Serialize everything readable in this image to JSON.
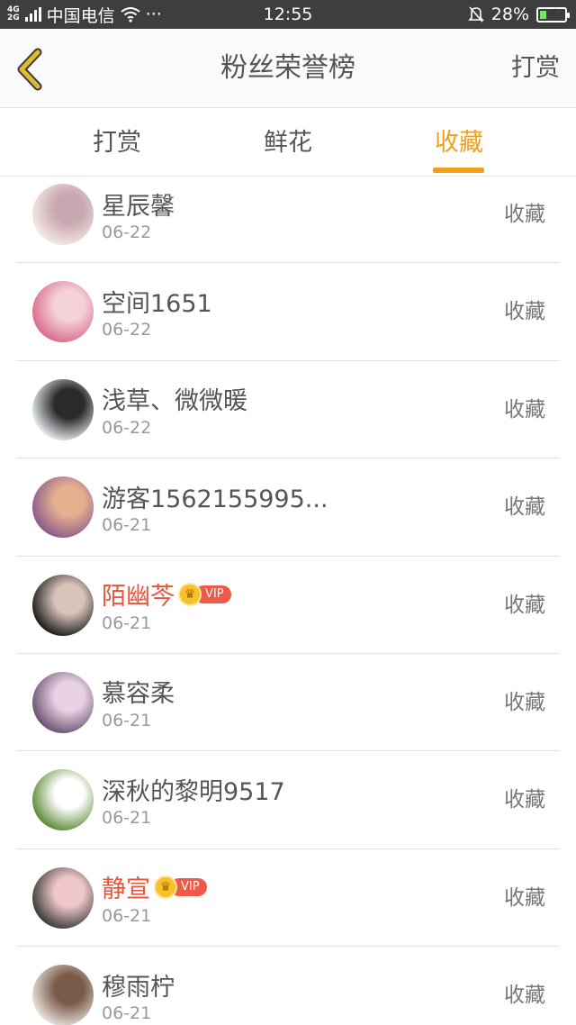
{
  "status_bar": {
    "network_top": "4G",
    "network_bottom": "2G",
    "carrier": "中国电信",
    "wifi_icon": "wifi-icon",
    "more": "···",
    "time": "12:55",
    "battery_percent": "28%",
    "battery_level": 0.28
  },
  "header": {
    "back_icon": "chevron-left-icon",
    "title": "粉丝荣誉榜",
    "action": "打赏"
  },
  "tabs": [
    {
      "label": "打赏",
      "active": false
    },
    {
      "label": "鲜花",
      "active": false
    },
    {
      "label": "收藏",
      "active": true
    }
  ],
  "colors": {
    "accent": "#f0a01a",
    "vip_name": "#e8553a",
    "back_icon": "#e2ba2c"
  },
  "list": [
    {
      "name": "星辰馨",
      "date": "06-22",
      "action": "收藏",
      "vip": false,
      "avatar_colors": [
        "#f3e9e6",
        "#c9a7b0"
      ]
    },
    {
      "name": "空间1651",
      "date": "06-22",
      "action": "收藏",
      "vip": false,
      "avatar_colors": [
        "#d86c8b",
        "#f5d2da"
      ]
    },
    {
      "name": "浅草、微微暖",
      "date": "06-22",
      "action": "收藏",
      "vip": false,
      "avatar_colors": [
        "#e9edf1",
        "#2a2a2a"
      ]
    },
    {
      "name": "游客1562155995...",
      "date": "06-21",
      "action": "收藏",
      "vip": false,
      "avatar_colors": [
        "#8a5a8e",
        "#e6b08f"
      ]
    },
    {
      "name": "陌幽芩",
      "date": "06-21",
      "action": "收藏",
      "vip": true,
      "vip_label": "VIP",
      "avatar_colors": [
        "#1b1b1b",
        "#d9c4bb"
      ]
    },
    {
      "name": "慕容柔",
      "date": "06-21",
      "action": "收藏",
      "vip": false,
      "avatar_colors": [
        "#6b5172",
        "#e8d2e4"
      ]
    },
    {
      "name": "深秋的黎明9517",
      "date": "06-21",
      "action": "收藏",
      "vip": false,
      "avatar_colors": [
        "#5d8a3a",
        "#ffffff"
      ]
    },
    {
      "name": "静宣",
      "date": "06-21",
      "action": "收藏",
      "vip": true,
      "vip_label": "VIP",
      "avatar_colors": [
        "#3b3b3b",
        "#efc7c8"
      ]
    },
    {
      "name": "穆雨柠",
      "date": "06-21",
      "action": "收藏",
      "vip": false,
      "avatar_colors": [
        "#e8e2dc",
        "#7a5b4a"
      ]
    }
  ]
}
